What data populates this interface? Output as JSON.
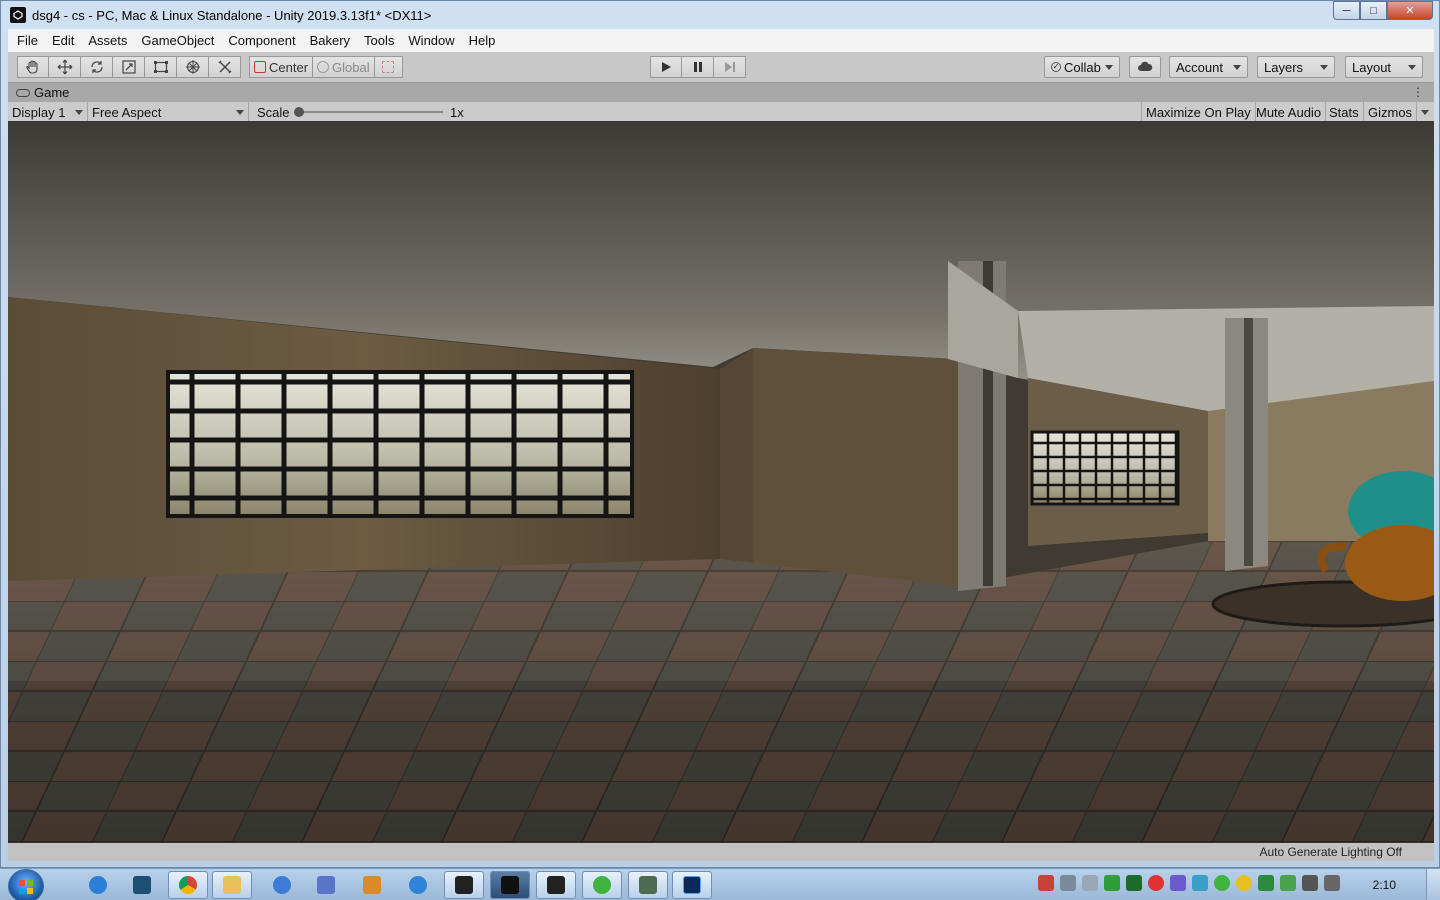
{
  "window": {
    "title": "dsg4 - cs - PC, Mac & Linux Standalone - Unity 2019.3.13f1* <DX11>",
    "min_label": "─",
    "max_label": "□",
    "close_label": "✕"
  },
  "menu": {
    "items": [
      {
        "label": "File"
      },
      {
        "label": "Edit"
      },
      {
        "label": "Assets"
      },
      {
        "label": "GameObject"
      },
      {
        "label": "Component"
      },
      {
        "label": "Bakery"
      },
      {
        "label": "Tools"
      },
      {
        "label": "Window"
      },
      {
        "label": "Help"
      }
    ]
  },
  "toolbar": {
    "tools": [
      {
        "icon": "hand-tool-icon"
      },
      {
        "icon": "move-tool-icon"
      },
      {
        "icon": "rotate-tool-icon"
      },
      {
        "icon": "scale-tool-icon"
      },
      {
        "icon": "rect-tool-icon"
      },
      {
        "icon": "transform-tool-icon"
      },
      {
        "icon": "custom-tool-icon"
      }
    ],
    "pivot_label": "Center",
    "space_label": "Global",
    "collab_label": "Collab",
    "account_label": "Account",
    "layers_label": "Layers",
    "layout_label": "Layout"
  },
  "game": {
    "tab_label": "Game",
    "display_label": "Display 1",
    "aspect_label": "Free Aspect",
    "scale_label": "Scale",
    "scale_value": "1x",
    "maximize_label": "Maximize On Play",
    "mute_label": "Mute Audio",
    "stats_label": "Stats",
    "gizmos_label": "Gizmos"
  },
  "status": {
    "text": "Auto Generate Lighting Off"
  },
  "taskbar": {
    "clock": "2:10",
    "colors": {
      "accent": "#1b5aa6",
      "ps": "#0b2a5a"
    }
  }
}
